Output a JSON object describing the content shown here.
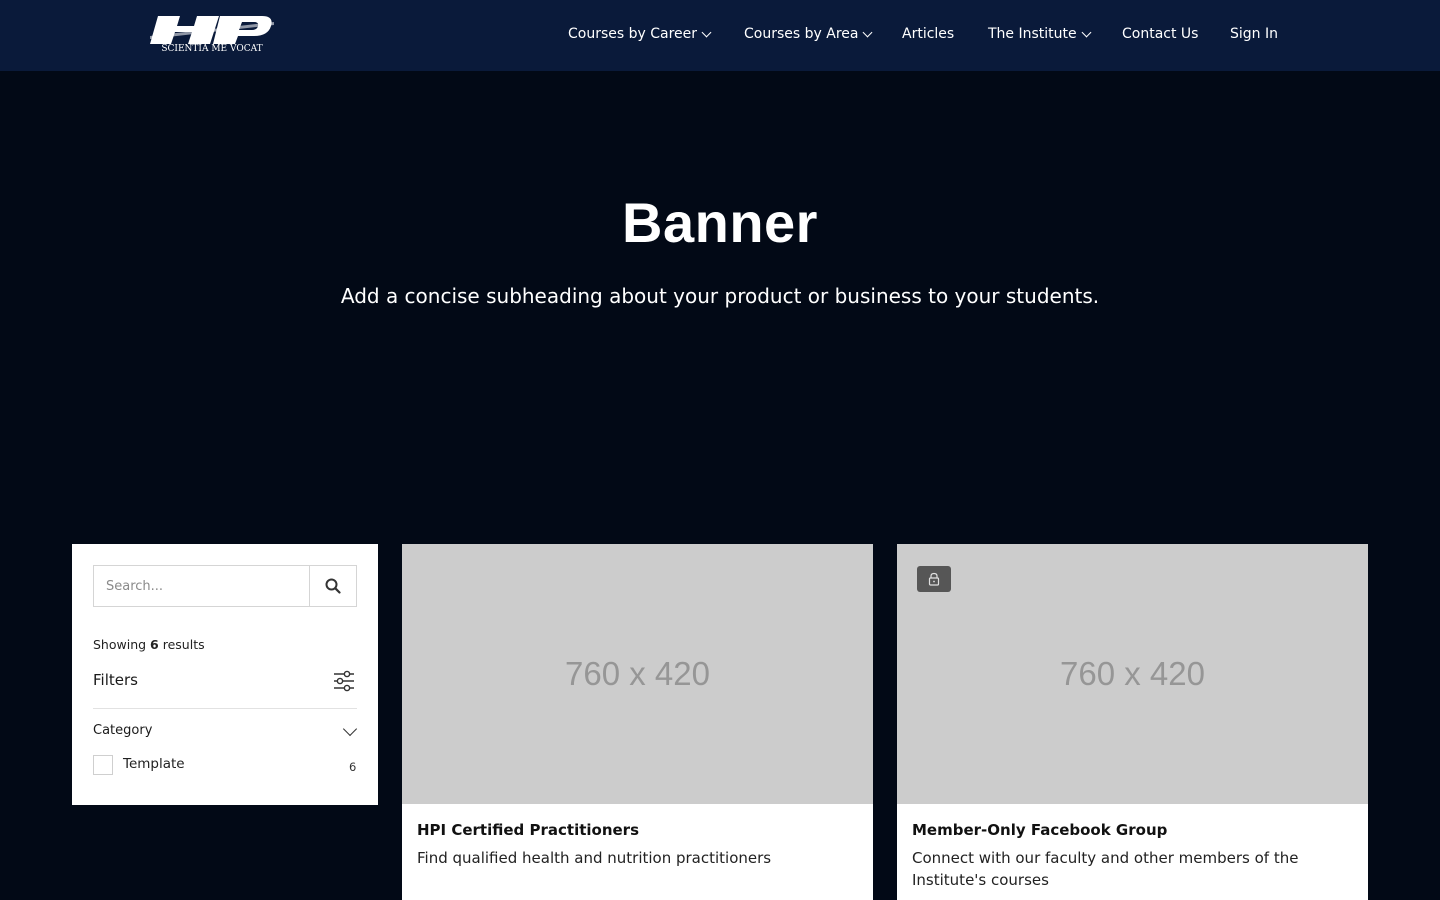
{
  "header": {
    "logo": {
      "text": "HP",
      "tagline": "SCIENTIA ME VOCAT"
    },
    "nav": [
      {
        "label": "Courses by Career",
        "has_dropdown": true
      },
      {
        "label": "Courses by Area",
        "has_dropdown": true
      },
      {
        "label": "Articles",
        "has_dropdown": false
      },
      {
        "label": "The Institute",
        "has_dropdown": true
      },
      {
        "label": "Contact Us",
        "has_dropdown": false
      },
      {
        "label": "Sign In",
        "has_dropdown": false
      }
    ]
  },
  "banner": {
    "title": "Banner",
    "subtitle": "Add a concise subheading about your product or business to your students."
  },
  "sidebar": {
    "search": {
      "placeholder": "Search...",
      "value": "",
      "button_icon": "search-icon"
    },
    "showing": {
      "prefix": "Showing",
      "count": "6",
      "suffix": "results"
    },
    "filters_title": "Filters",
    "filters_icon": "sliders-icon",
    "category": {
      "label": "Category",
      "options": [
        {
          "label": "Template",
          "count": "6",
          "checked": false
        }
      ]
    }
  },
  "cards": [
    {
      "image_placeholder": "760 x 420",
      "locked": false,
      "title": "HPI Certified Practitioners",
      "description": "Find qualified health and nutrition practitioners"
    },
    {
      "image_placeholder": "760 x 420",
      "locked": true,
      "title": "Member-Only Facebook Group",
      "description": "Connect with our faculty and other members of the Institute's courses"
    }
  ],
  "colors": {
    "page_background": "#020916",
    "header_background": "#0a1a3a",
    "card_image_placeholder": "#cccccc",
    "lock_badge": "#565656"
  }
}
